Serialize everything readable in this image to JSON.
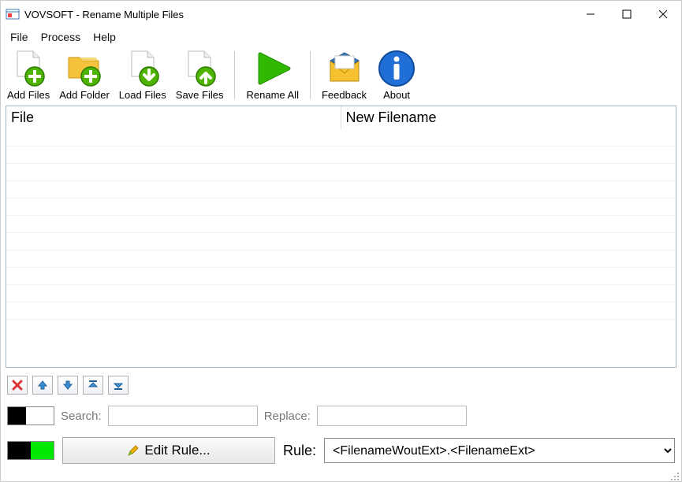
{
  "title": "VOVSOFT - Rename Multiple Files",
  "menu": {
    "file": "File",
    "process": "Process",
    "help": "Help"
  },
  "toolbar": {
    "add_files": "Add Files",
    "add_folder": "Add Folder",
    "load_files": "Load Files",
    "save_files": "Save Files",
    "rename_all": "Rename All",
    "feedback": "Feedback",
    "about": "About"
  },
  "grid": {
    "col_file": "File",
    "col_newname": "New Filename",
    "rows": []
  },
  "search": {
    "label": "Search:",
    "value": ""
  },
  "replace": {
    "label": "Replace:",
    "value": ""
  },
  "rule": {
    "edit_label": "Edit Rule...",
    "label": "Rule:",
    "value": "<FilenameWoutExt>.<FilenameExt>"
  }
}
